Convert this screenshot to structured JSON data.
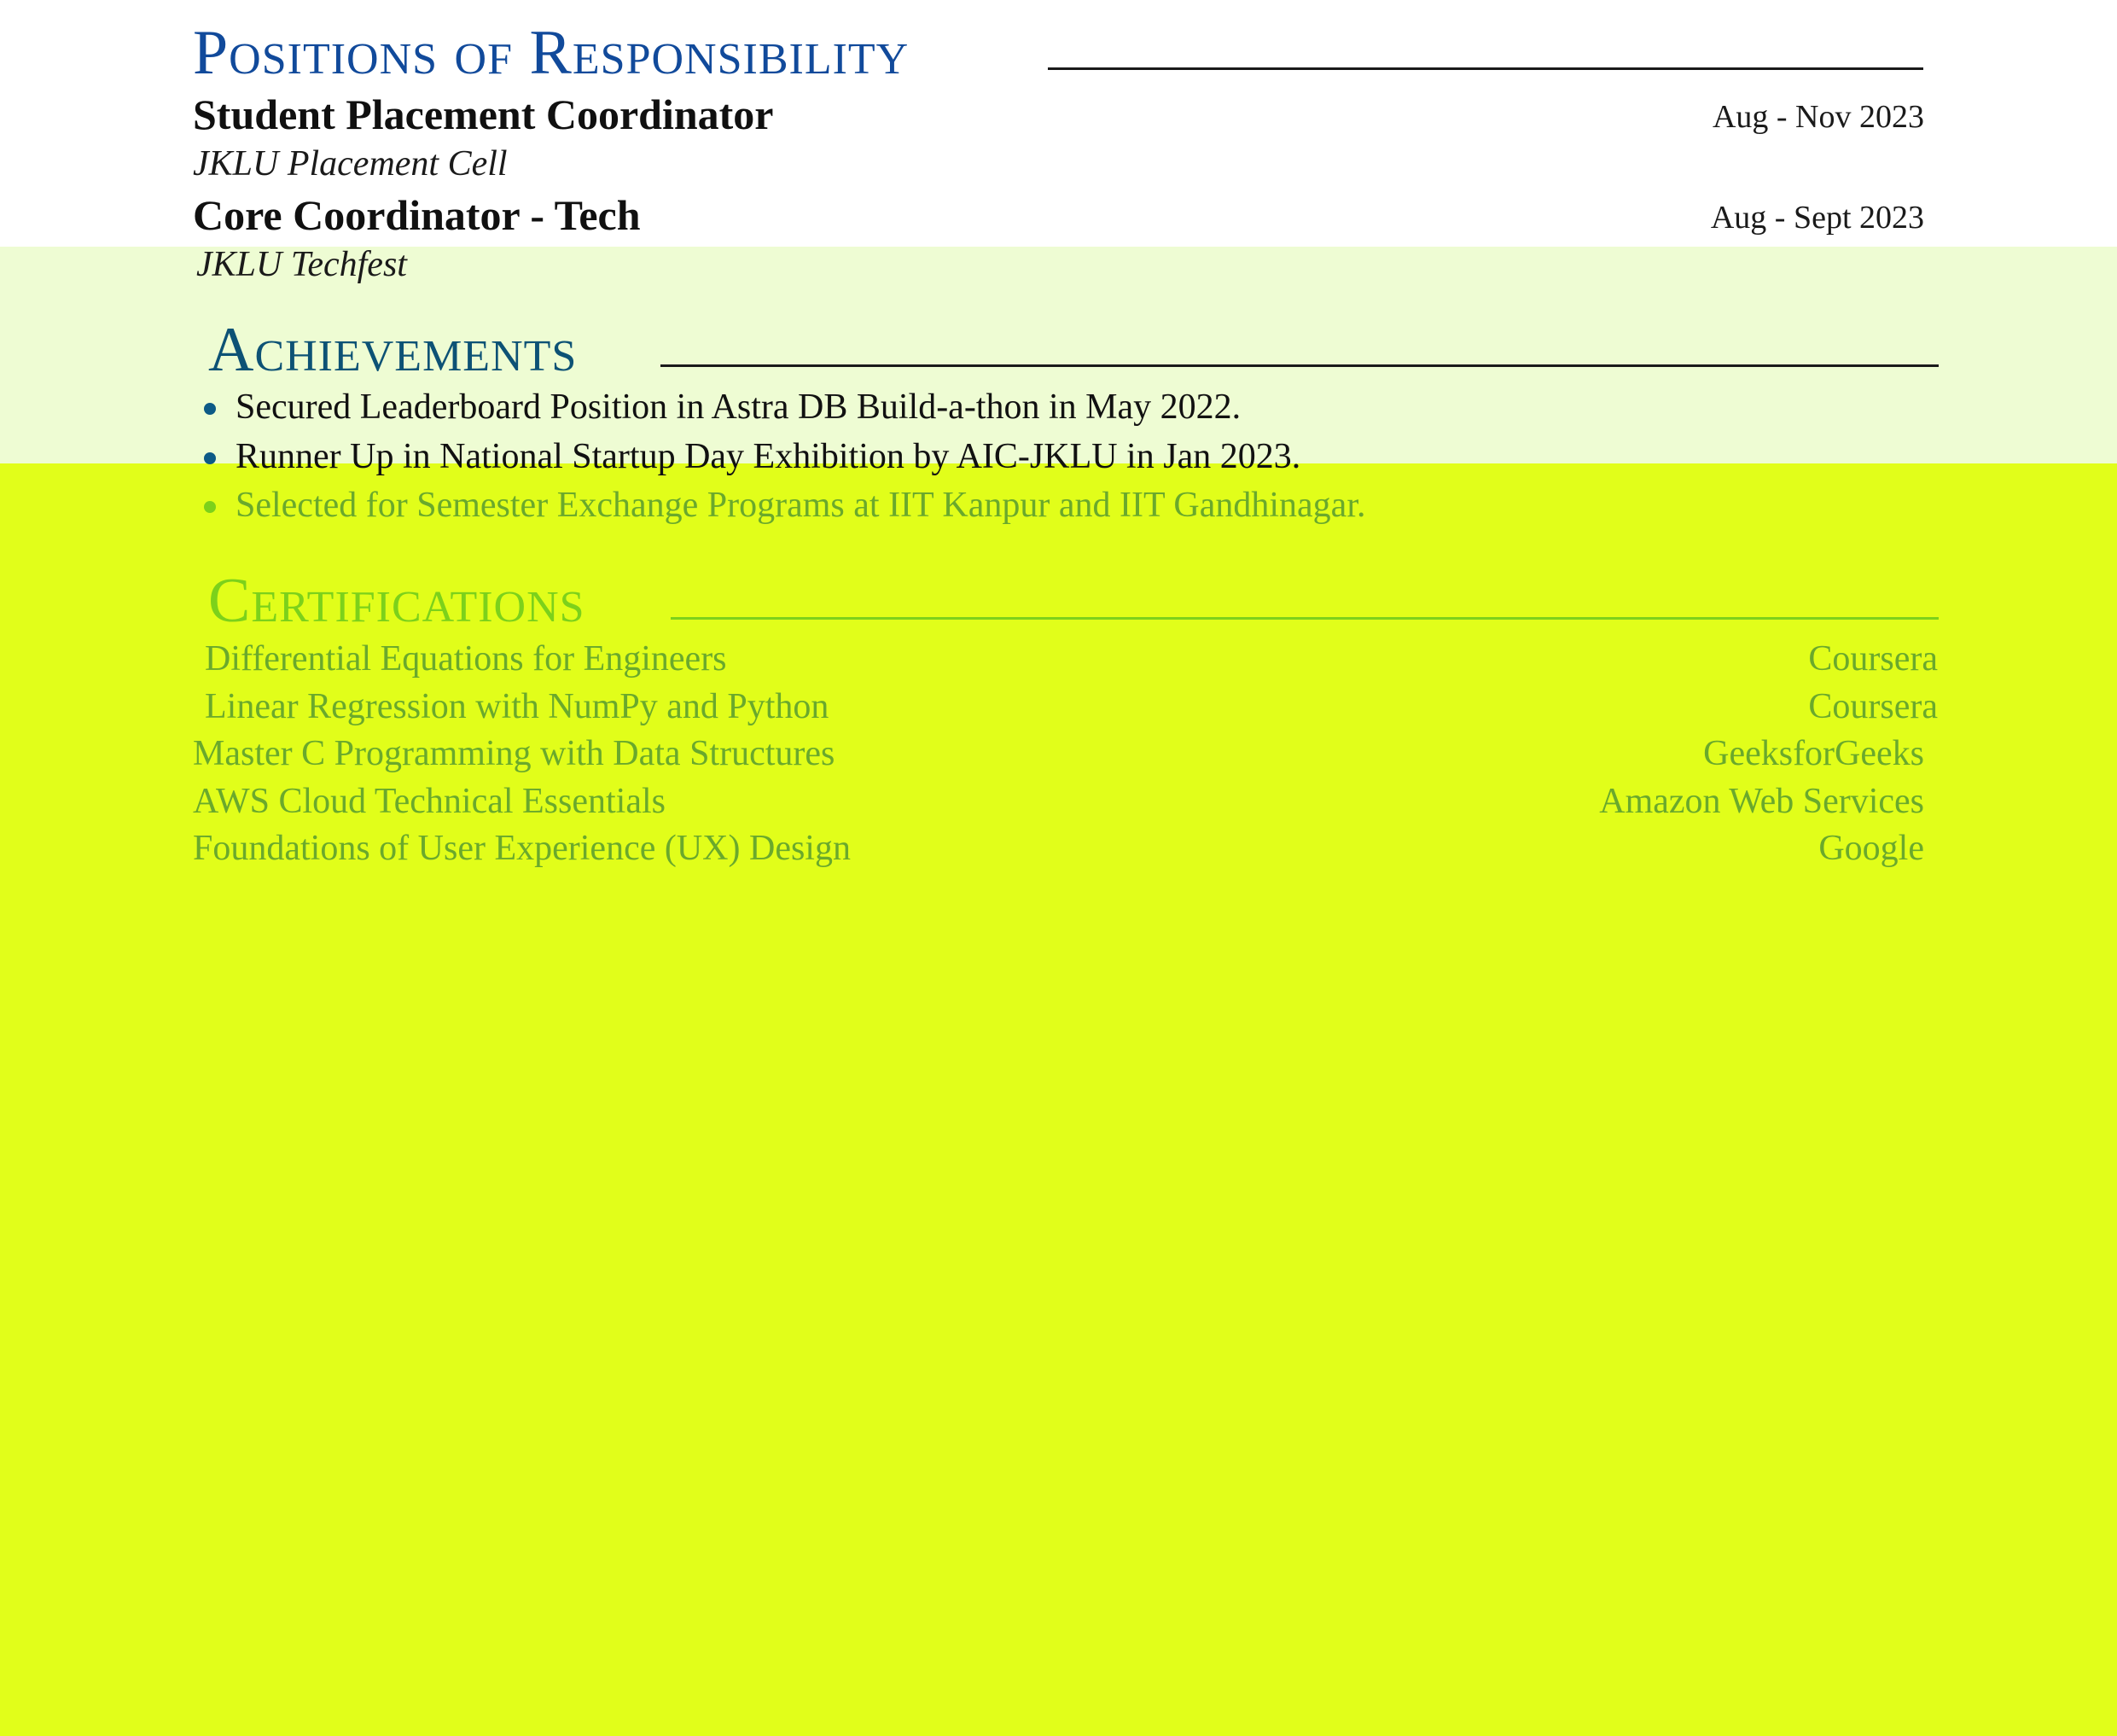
{
  "colors": {
    "heading_blue": "#114a9b",
    "heading_teal": "#0d5275",
    "bullet_blue": "#0d5a86",
    "green_text": "#6aa92c",
    "green_heading": "#7cd11b",
    "band_mid": "#eefcd3",
    "band_bottom": "#e1fe1a"
  },
  "positions": {
    "title": "Positions of Responsibility",
    "items": [
      {
        "role": "Student Placement Coordinator",
        "org": "JKLU Placement Cell",
        "date": "Aug - Nov 2023"
      },
      {
        "role": "Core Coordinator - Tech",
        "org": "JKLU Techfest",
        "date": "Aug - Sept 2023"
      }
    ]
  },
  "achievements": {
    "title": "Achievements",
    "items": [
      "Secured Leaderboard Position in Astra DB Build-a-thon in May 2022.",
      "Runner Up in National Startup Day Exhibition by AIC-JKLU in Jan 2023.",
      "Selected for Semester Exchange Programs at IIT Kanpur and IIT Gandhinagar."
    ]
  },
  "certifications": {
    "title": "Certifications",
    "items": [
      {
        "name": "Differential Equations for Engineers",
        "provider": "Coursera"
      },
      {
        "name": "Linear Regression with NumPy and Python",
        "provider": "Coursera"
      },
      {
        "name": "Master C Programming with Data Structures",
        "provider": "GeeksforGeeks"
      },
      {
        "name": "AWS Cloud Technical Essentials",
        "provider": "Amazon Web Services"
      },
      {
        "name": "Foundations of User Experience (UX) Design",
        "provider": "Google"
      }
    ]
  }
}
